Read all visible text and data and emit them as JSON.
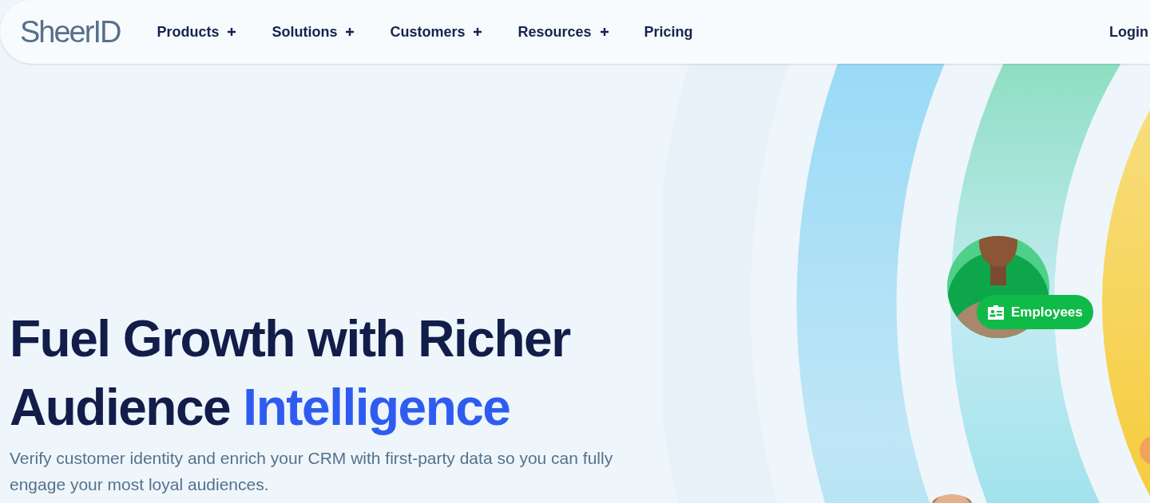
{
  "logo": "SheerID",
  "nav": [
    {
      "label": "Products",
      "has_menu": true
    },
    {
      "label": "Solutions",
      "has_menu": true
    },
    {
      "label": "Customers",
      "has_menu": true
    },
    {
      "label": "Resources",
      "has_menu": true
    },
    {
      "label": "Pricing",
      "has_menu": false
    }
  ],
  "login": "Login",
  "hero": {
    "title": "Fuel Growth with Richer",
    "title_plain": "Audience ",
    "title_highlight": "Intelligence",
    "subtitle": "Verify customer identity and enrich your CRM with first-party data so you can fully engage your most loyal audiences."
  },
  "badge": {
    "label": "Employees"
  }
}
